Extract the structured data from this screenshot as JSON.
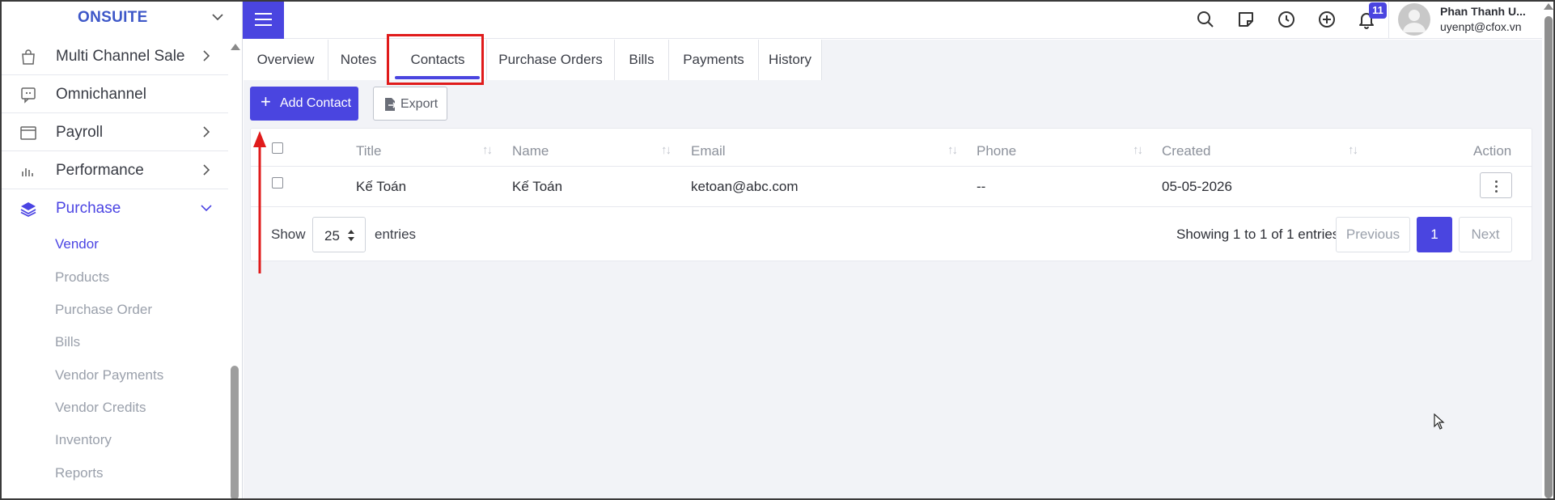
{
  "sidebar": {
    "brand": "ONSUITE",
    "items": [
      {
        "label": "Multi Channel Sale",
        "icon": "shopping-bag-icon",
        "has_chevron": true
      },
      {
        "label": "Omnichannel",
        "icon": "chat-bubble-icon",
        "has_chevron": false
      },
      {
        "label": "Payroll",
        "icon": "window-icon",
        "has_chevron": true
      },
      {
        "label": "Performance",
        "icon": "bar-chart-icon",
        "has_chevron": true
      },
      {
        "label": "Purchase",
        "icon": "layers-icon",
        "has_chevron": true,
        "expanded": true
      }
    ],
    "sub_items": [
      "Vendor",
      "Products",
      "Purchase Order",
      "Bills",
      "Vendor Payments",
      "Vendor Credits",
      "Inventory",
      "Reports"
    ],
    "active_sub_item": "Vendor"
  },
  "topbar": {
    "notification_count": "11",
    "user_name": "Phan Thanh U...",
    "user_email": "uyenpt@cfox.vn",
    "icons": [
      "search-icon",
      "note-icon",
      "clock-icon",
      "plus-circle-icon",
      "bell-icon"
    ]
  },
  "tabs": [
    "Overview",
    "Notes",
    "Contacts",
    "Purchase Orders",
    "Bills",
    "Payments",
    "History"
  ],
  "active_tab": "Contacts",
  "toolbar": {
    "add_label": "Add Contact",
    "export_label": "Export"
  },
  "table": {
    "columns": [
      "Title",
      "Name",
      "Email",
      "Phone",
      "Created",
      "Action"
    ],
    "rows": [
      {
        "title": "Kế Toán",
        "name": "Kế Toán",
        "email": "ketoan@abc.com",
        "phone": "--",
        "created": "05-05-2026"
      }
    ]
  },
  "pagination": {
    "show_label": "Show",
    "entries_value": "25",
    "entries_label": "entries",
    "summary": "Showing 1 to 1 of 1 entries",
    "previous": "Previous",
    "current_page": "1",
    "next": "Next"
  },
  "colors": {
    "accent": "#4a45e0",
    "brand": "#3d57c8",
    "annotation": "#e01b1b"
  }
}
